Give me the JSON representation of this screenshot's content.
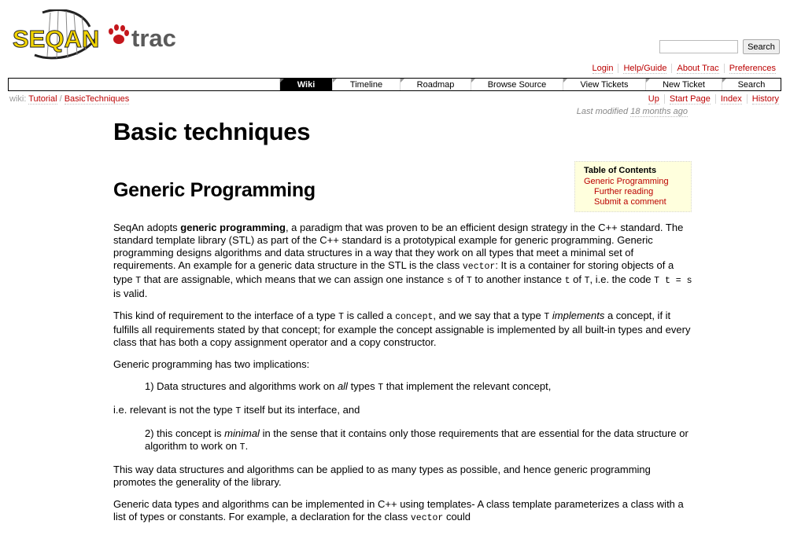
{
  "logo": {
    "left_text": "SEQAN",
    "right_text": "trac"
  },
  "search": {
    "placeholder": "",
    "button_label": "Search"
  },
  "metanav": [
    "Login",
    "Help/Guide",
    "About Trac",
    "Preferences"
  ],
  "mainnav": [
    {
      "label": "Wiki",
      "active": true
    },
    {
      "label": "Timeline",
      "active": false
    },
    {
      "label": "Roadmap",
      "active": false
    },
    {
      "label": "Browse Source",
      "active": false
    },
    {
      "label": "View Tickets",
      "active": false
    },
    {
      "label": "New Ticket",
      "active": false
    },
    {
      "label": "Search",
      "active": false
    }
  ],
  "breadcrumb": {
    "prefix": "wiki:",
    "items": [
      "Tutorial",
      "BasicTechniques"
    ],
    "sep": "/"
  },
  "ctxtnav": [
    "Up",
    "Start Page",
    "Index",
    "History"
  ],
  "lastmod": {
    "prefix": "Last modified",
    "ago": "18 months ago"
  },
  "page_title": "Basic techniques",
  "section_title": "Generic Programming",
  "toc": {
    "title": "Table of Contents",
    "items": [
      "Generic Programming",
      "Further reading",
      "Submit a comment"
    ]
  },
  "body": {
    "p1": {
      "a": "SeqAn adopts ",
      "b": "generic programming",
      "c": ", a paradigm that was proven to be an efficient design strategy in the C++ standard. The standard template library (STL) as part of the C++ standard is a prototypical example for generic programming. Generic programming designs algorithms and data structures in a way that they work on all types that meet a minimal set of requirements. An example for a generic data structure in the STL is the class ",
      "code1": "vector",
      "d": ": It is a container for storing objects of a type ",
      "code2": "T",
      "e": " that are assignable, which means that we can assign one instance ",
      "code3": "s",
      "f": " of ",
      "code4": "T",
      "g": " to another instance ",
      "code5": "t",
      "h": " of ",
      "code6": "T",
      "i": ", i.e. the code ",
      "code7": "T t = s",
      "j": " is valid."
    },
    "p2": {
      "a": "This kind of requirement to the interface of a type ",
      "code1": "T",
      "b": " is called a ",
      "code2": "concept",
      "c": ", and we say that a type ",
      "code3": "T",
      "em": "implements",
      "d": " a concept, if it fulfills all requirements stated by that concept; for example the concept assignable is implemented by all built-in types and every class that has both a copy assignment operator and a copy constructor."
    },
    "p3": "Generic programming has two implications:",
    "q1": {
      "a": "1) Data structures and algorithms work on ",
      "em": "all",
      "b": " types ",
      "code": "T",
      "c": " that implement the relevant concept,"
    },
    "p4": {
      "a": "i.e. relevant is not the type ",
      "code": "T",
      "b": " itself but its interface, and"
    },
    "q2": {
      "a": "2) this concept is ",
      "em": "minimal",
      "b": " in the sense that it contains only those requirements that are essential for the data structure or algorithm to work on ",
      "code": "T",
      "c": "."
    },
    "p5": "This way data structures and algorithms can be applied to as many types as possible, and hence generic programming promotes the generality of the library.",
    "p6": {
      "a": "Generic data types and algorithms can be implemented in C++ using templates- A class template parameterizes a class with a list of types or constants. For example, a declaration for the class ",
      "code": "vector",
      "b": " could"
    }
  },
  "colors": {
    "link": "#bb0000",
    "toc_bg": "#ffffdd",
    "nav_active_bg": "#000000",
    "logo_yellow": "#f2d400",
    "logo_red": "#c4161c",
    "logo_gray": "#5a5a5a"
  }
}
